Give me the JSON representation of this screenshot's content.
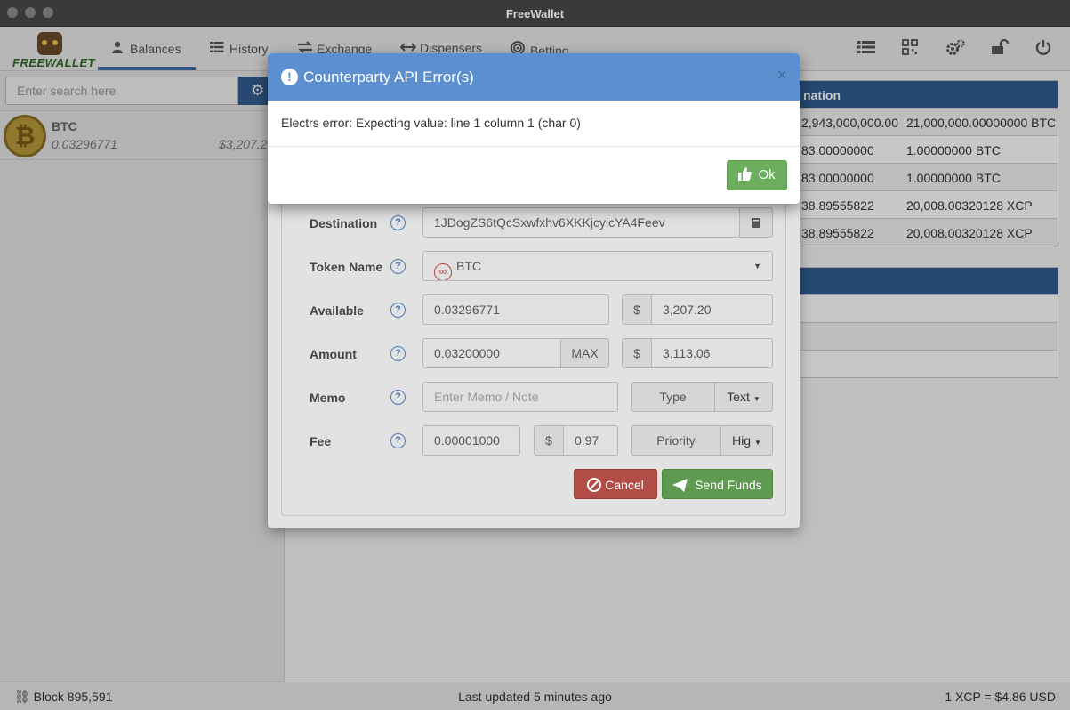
{
  "window": {
    "title": "FreeWallet"
  },
  "logo": {
    "text": "FREEWALLET"
  },
  "nav": {
    "tabs": [
      {
        "label": "Balances",
        "icon": "user-icon"
      },
      {
        "label": "History",
        "icon": "list-icon"
      },
      {
        "label": "Exchange",
        "icon": "exchange-icon"
      },
      {
        "label": "Dispensers",
        "icon": "arrows-h-icon"
      },
      {
        "label": "Betting",
        "icon": "bullseye-icon"
      }
    ],
    "right_icons": [
      "list-icon",
      "qrcode-icon",
      "cogs-icon",
      "unlock-icon",
      "power-icon"
    ]
  },
  "sidebar": {
    "search_placeholder": "Enter search here",
    "balances": [
      {
        "symbol": "BTC",
        "amount": "0.03296771",
        "usd": "$3,207.2"
      }
    ]
  },
  "tables": {
    "top_header": "nation",
    "top_rows": [
      {
        "c1": "2,943,000,000.00",
        "c2": "21,000,000.00000000 BTC"
      },
      {
        "c1": "83.00000000",
        "c2": "1.00000000 BTC"
      },
      {
        "c1": "83.00000000",
        "c2": "1.00000000 BTC"
      },
      {
        "c1": "38.89555822",
        "c2": "20,008.00320128 XCP"
      },
      {
        "c1": "38.89555822",
        "c2": "20,008.00320128 XCP"
      }
    ]
  },
  "send": {
    "destination_label": "Destination",
    "destination_value": "1JDogZS6tQcSxwfxhv6XKKjcyicYA4Feev",
    "token_label": "Token Name",
    "token_value": "BTC",
    "available_label": "Available",
    "available_value": "0.03296771",
    "available_usd": "3,207.20",
    "amount_label": "Amount",
    "amount_value": "0.03200000",
    "max_label": "MAX",
    "amount_usd": "3,113.06",
    "memo_label": "Memo",
    "memo_placeholder": "Enter Memo / Note",
    "type_label": "Type",
    "type_value": "Text",
    "fee_label": "Fee",
    "fee_value": "0.00001000",
    "fee_usd": "0.97",
    "priority_label": "Priority",
    "priority_value": "Hig",
    "currency_symbol": "$",
    "cancel_label": "Cancel",
    "send_label": "Send Funds",
    "help_symbol": "?"
  },
  "modal": {
    "title": "Counterparty API Error(s)",
    "message": "Electrs error: Expecting value: line 1 column 1 (char 0)",
    "ok_label": "Ok",
    "close_symbol": "×"
  },
  "status": {
    "block": "Block 895,591",
    "updated": "Last updated 5 minutes ago",
    "price": "1 XCP = $4.86 USD"
  },
  "colors": {
    "accent": "#335e91",
    "modal_header": "#5b8fcf",
    "ok_green": "#6cae5d",
    "cancel_red": "#b24c47"
  }
}
